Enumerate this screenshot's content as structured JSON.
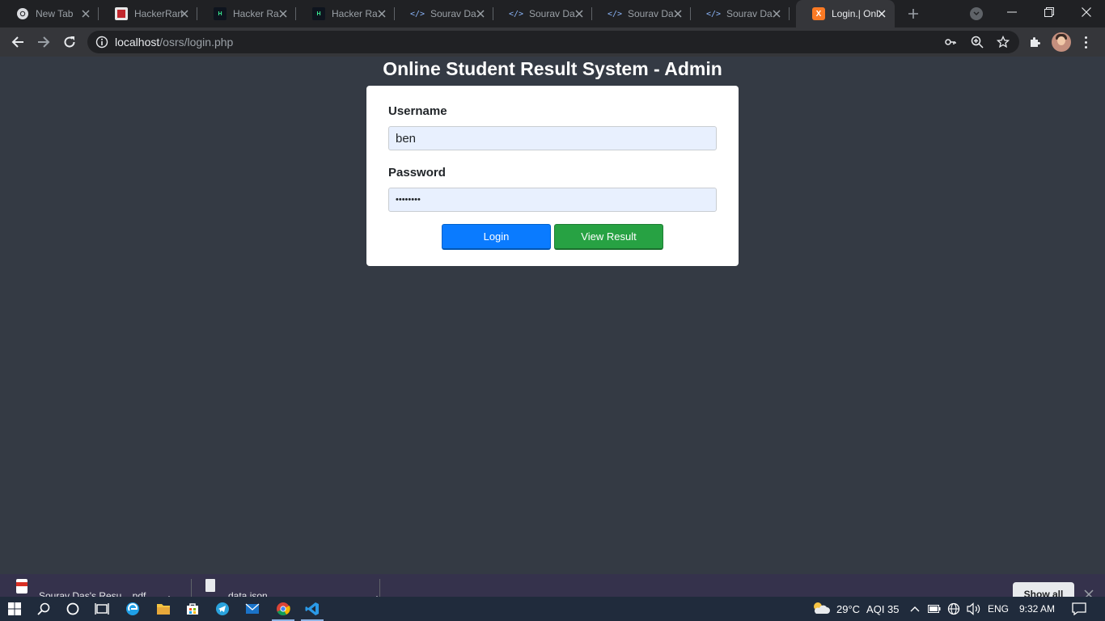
{
  "browser": {
    "tabs": [
      {
        "title": "New Tab",
        "icon": "chrome-icon"
      },
      {
        "title": "HackerRan",
        "icon": "hackerrank-icon"
      },
      {
        "title": "Hacker Ra",
        "icon": "hackerrank-icon"
      },
      {
        "title": "Hacker Ra",
        "icon": "hackerrank-icon"
      },
      {
        "title": "Sourav Da",
        "icon": "code-icon"
      },
      {
        "title": "Sourav Da",
        "icon": "code-icon"
      },
      {
        "title": "Sourav Da",
        "icon": "code-icon"
      },
      {
        "title": "Sourav Da",
        "icon": "code-icon"
      },
      {
        "title": "Login.| Onl",
        "icon": "xampp-icon",
        "active": true
      }
    ],
    "url_host": "localhost",
    "url_path": "/osrs/login.php"
  },
  "page": {
    "title": "Online Student Result System - Admin",
    "username_label": "Username",
    "username_value": "ben",
    "password_label": "Password",
    "password_value": "••••••••",
    "login_button": "Login",
    "view_result_button": "View Result"
  },
  "downloads": {
    "items": [
      {
        "name": "Sourav Das's Resu....pdf",
        "icon": "pdf-icon"
      },
      {
        "name": "data.json",
        "icon": "file-icon"
      }
    ],
    "show_all": "Show all"
  },
  "taskbar": {
    "temperature": "29°C",
    "aqi": "AQI 35",
    "language": "ENG",
    "time": "9:32 AM"
  },
  "colors": {
    "page_bg": "#343a44",
    "login_button": "#0a7bff",
    "view_result_button": "#27a243",
    "input_bg": "#e8f0fe"
  }
}
